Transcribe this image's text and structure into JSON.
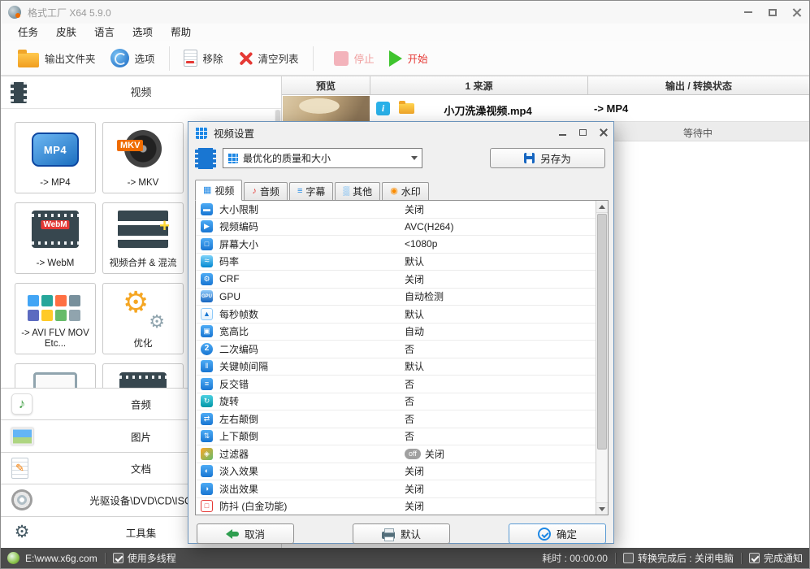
{
  "window": {
    "title": "格式工厂 X64 5.9.0",
    "menu": [
      "任务",
      "皮肤",
      "语言",
      "选项",
      "帮助"
    ]
  },
  "toolbar": {
    "output_folder": "输出文件夹",
    "options": "选项",
    "remove": "移除",
    "clear_list": "清空列表",
    "stop": "停止",
    "start": "开始"
  },
  "sidebar": {
    "section_title": "视频",
    "tiles": [
      {
        "icon": "mp4-tile-icon",
        "badge": "MP4",
        "label": "-> MP4"
      },
      {
        "icon": "mkv-tile-icon",
        "badge": "MKV",
        "label": "-> MKV"
      },
      {
        "icon": "webm-tile-icon",
        "badge": "WebM",
        "label": "-> WebM"
      },
      {
        "icon": "merge-tile-icon",
        "badge": "",
        "label": "视频合并 & 混流"
      },
      {
        "icon": "multi-format-tile-icon",
        "badge": "",
        "label": "-> AVI FLV MOV Etc..."
      },
      {
        "icon": "optimize-tile-icon",
        "badge": "",
        "label": "优化"
      },
      {
        "icon": "screen-tile-icon",
        "badge": "",
        "label": ""
      },
      {
        "icon": "film-tile-icon",
        "badge": "",
        "label": ""
      }
    ],
    "categories": [
      {
        "icon": "audio-category-icon",
        "label": "音频"
      },
      {
        "icon": "picture-category-icon",
        "label": "图片"
      },
      {
        "icon": "document-category-icon",
        "label": "文档"
      },
      {
        "icon": "disc-category-icon",
        "label": "光驱设备\\DVD\\CD\\ISO"
      },
      {
        "icon": "toolset-category-icon",
        "label": "工具集"
      }
    ]
  },
  "queue": {
    "columns": [
      "预览",
      "1 来源",
      "输出 / 转换状态"
    ],
    "item": {
      "source": "小刀洗澡视频.mp4",
      "output": "-> MP4",
      "status": "等待中"
    }
  },
  "statusbar": {
    "site": "E:\\www.x6g.com",
    "multithread": "使用多线程",
    "elapsed": "耗时 : 00:00:00",
    "after_convert": "转换完成后 : 关闭电脑",
    "notify": "完成通知"
  },
  "dialog": {
    "title": "视频设置",
    "profile": "最优化的质量和大小",
    "save_as": "另存为",
    "tabs": [
      {
        "icon": "video-tab-icon",
        "label": "视频"
      },
      {
        "icon": "audio-tab-icon",
        "label": "音频"
      },
      {
        "icon": "subtitle-tab-icon",
        "label": "字幕"
      },
      {
        "icon": "other-tab-icon",
        "label": "其他"
      },
      {
        "icon": "watermark-tab-icon",
        "label": "水印"
      }
    ],
    "settings": [
      {
        "icon": "size-limit-icon",
        "label": "大小限制",
        "value": "关闭"
      },
      {
        "icon": "video-encoder-icon",
        "label": "视频编码",
        "value": "AVC(H264)"
      },
      {
        "icon": "screen-size-icon",
        "label": "屏幕大小",
        "value": "<1080p"
      },
      {
        "icon": "bitrate-icon",
        "label": "码率",
        "value": "默认"
      },
      {
        "icon": "crf-icon",
        "label": "CRF",
        "value": "关闭"
      },
      {
        "icon": "gpu-icon",
        "label": "GPU",
        "value": "自动检测"
      },
      {
        "icon": "fps-icon",
        "label": "每秒帧数",
        "value": "默认"
      },
      {
        "icon": "aspect-ratio-icon",
        "label": "宽高比",
        "value": "自动"
      },
      {
        "icon": "two-pass-icon",
        "label": "二次编码",
        "value": "否"
      },
      {
        "icon": "keyframe-icon",
        "label": "关键帧间隔",
        "value": "默认"
      },
      {
        "icon": "deinterlace-icon",
        "label": "反交错",
        "value": "否"
      },
      {
        "icon": "rotate-icon",
        "label": "旋转",
        "value": "否"
      },
      {
        "icon": "flip-horizontal-icon",
        "label": "左右颠倒",
        "value": "否"
      },
      {
        "icon": "flip-vertical-icon",
        "label": "上下颠倒",
        "value": "否"
      },
      {
        "icon": "filter-icon",
        "label": "过滤器",
        "value": "关闭",
        "toggle": "off"
      },
      {
        "icon": "fade-in-icon",
        "label": "淡入效果",
        "value": "关闭"
      },
      {
        "icon": "fade-out-icon",
        "label": "淡出效果",
        "value": "关闭"
      },
      {
        "icon": "stabilize-icon",
        "label": "防抖 (白金功能)",
        "value": "关闭"
      }
    ],
    "buttons": {
      "cancel": "取消",
      "default": "默认",
      "ok": "确定"
    }
  },
  "colors": {
    "accent_blue": "#1e88e5",
    "start_green": "#3fc42e",
    "stop_pink": "#f3b3bb",
    "danger_red": "#e53935",
    "statusbar_bg": "#4b4b4b"
  }
}
